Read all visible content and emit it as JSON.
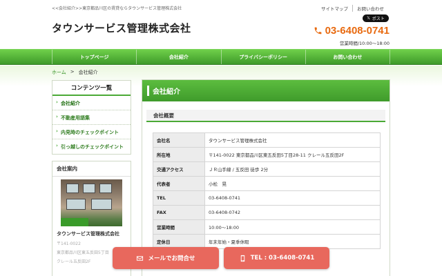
{
  "header": {
    "topline": "<<会社紹介>>東京都品川区の賃貸ならタウンサービス管理株式会社",
    "links": [
      "サイトマップ",
      "お問い合わせ"
    ],
    "x_post": "ポスト",
    "logo": "タウンサービス管理株式会社",
    "phone": "03-6408-0741",
    "hours": "営業時間/10:00～18:00"
  },
  "nav": {
    "items": [
      "トップページ",
      "会社紹介",
      "プライバシーポリシー",
      "お問い合わせ"
    ]
  },
  "breadcrumb": {
    "home": "ホーム",
    "sep": ">",
    "current": "会社紹介"
  },
  "sidebar": {
    "contents_title": "コンテンツ一覧",
    "items": [
      "会社紹介",
      "不動産用語集",
      "内見時のチェックポイント",
      "引っ越しのチェックポイント"
    ],
    "about_title": "会社案内",
    "about_name": "タウンサービス管理株式会社",
    "about_lines": [
      "〒141-0022",
      "東京都品川区東五反田5丁目",
      "クレール五反田2F"
    ]
  },
  "main": {
    "title": "会社紹介",
    "subtitle": "会社概要",
    "rows": [
      {
        "k": "会社名",
        "v": "タウンサービス管理株式会社"
      },
      {
        "k": "所在地",
        "v": "〒141-0022 東京都品川区東五反田5丁目28-11 クレール五反田2F"
      },
      {
        "k": "交通アクセス",
        "v": "ＪＲ山手線 / 五反田 徒歩 2分"
      },
      {
        "k": "代表者",
        "v": "小松　晃"
      },
      {
        "k": "TEL",
        "v": "03-6408-0741"
      },
      {
        "k": "FAX",
        "v": "03-6408-0742"
      },
      {
        "k": "営業時間",
        "v": "10:00～18:00"
      },
      {
        "k": "定休日",
        "v": "年末年始・夏季休暇"
      }
    ]
  },
  "cta": {
    "mail": "メールでお問合せ",
    "tel": "TEL : 03-6408-0741"
  },
  "colors": {
    "accent_green": "#4aa935",
    "phone_orange": "#e86a10",
    "cta_red": "#e8685d"
  }
}
